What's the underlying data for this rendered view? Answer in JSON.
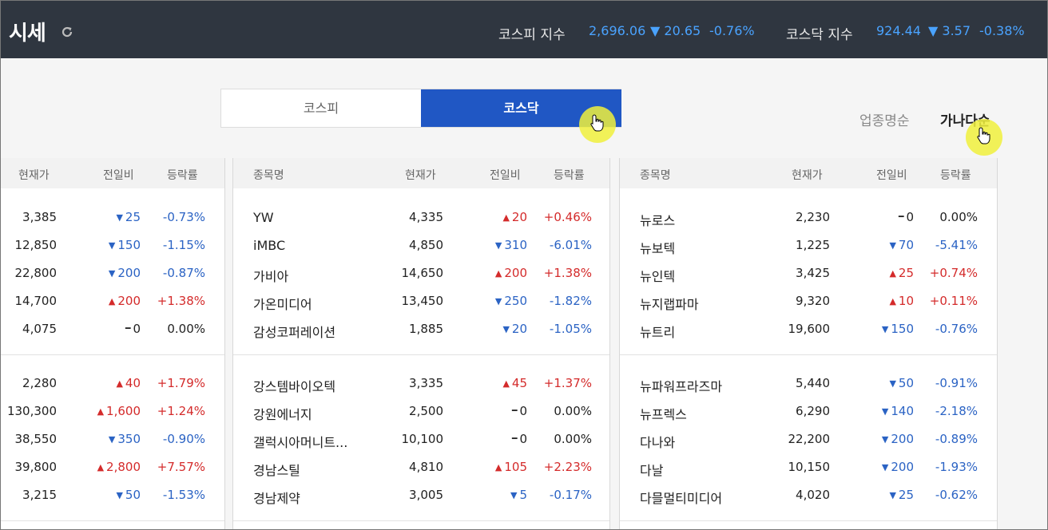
{
  "header": {
    "title": "시세",
    "kospi": {
      "name": "코스피 지수",
      "value": "2,696.06",
      "change": "▼ 20.65",
      "rate": "-0.76%"
    },
    "kosdaq": {
      "name": "코스닥 지수",
      "value": "924.44",
      "change": "▼ 3.57",
      "rate": "-0.38%"
    }
  },
  "market_tabs": {
    "kospi": "코스피",
    "kosdaq": "코스닥",
    "active": "kosdaq"
  },
  "sort": {
    "by_industry": "업종명순",
    "alphabetical": "가나다순",
    "active": "alphabetical"
  },
  "colors": {
    "header_bg": "#2f3640",
    "accent": "#2057c4",
    "up": "#d42b2b",
    "down": "#2b63c4"
  },
  "columns": {
    "name": "종목명",
    "price": "현재가",
    "change": "전일비",
    "rate": "등락률"
  },
  "left_panel": {
    "rows": [
      {
        "price": "3,385",
        "dir": "down",
        "change": "25",
        "rate": "-0.73%"
      },
      {
        "price": "12,850",
        "dir": "down",
        "change": "150",
        "rate": "-1.15%"
      },
      {
        "price": "22,800",
        "dir": "down",
        "change": "200",
        "rate": "-0.87%"
      },
      {
        "price": "14,700",
        "dir": "up",
        "change": "200",
        "rate": "+1.38%"
      },
      {
        "price": "4,075",
        "dir": "flat",
        "change": "0",
        "rate": "0.00%"
      },
      {
        "price": "2,280",
        "dir": "up",
        "change": "40",
        "rate": "+1.79%"
      },
      {
        "price": "130,300",
        "dir": "up",
        "change": "1,600",
        "rate": "+1.24%"
      },
      {
        "price": "38,550",
        "dir": "down",
        "change": "350",
        "rate": "-0.90%"
      },
      {
        "price": "39,800",
        "dir": "up",
        "change": "2,800",
        "rate": "+7.57%"
      },
      {
        "price": "3,215",
        "dir": "down",
        "change": "50",
        "rate": "-1.53%"
      }
    ]
  },
  "mid_panel": {
    "rows": [
      {
        "name": "YW",
        "price": "4,335",
        "dir": "up",
        "change": "20",
        "rate": "+0.46%"
      },
      {
        "name": "iMBC",
        "price": "4,850",
        "dir": "down",
        "change": "310",
        "rate": "-6.01%"
      },
      {
        "name": "가비아",
        "price": "14,650",
        "dir": "up",
        "change": "200",
        "rate": "+1.38%"
      },
      {
        "name": "가온미디어",
        "price": "13,450",
        "dir": "down",
        "change": "250",
        "rate": "-1.82%"
      },
      {
        "name": "감성코퍼레이션",
        "price": "1,885",
        "dir": "down",
        "change": "20",
        "rate": "-1.05%"
      },
      {
        "name": "강스템바이오텍",
        "price": "3,335",
        "dir": "up",
        "change": "45",
        "rate": "+1.37%"
      },
      {
        "name": "강원에너지",
        "price": "2,500",
        "dir": "flat",
        "change": "0",
        "rate": "0.00%"
      },
      {
        "name": "갤럭시아머니트...",
        "price": "10,100",
        "dir": "flat",
        "change": "0",
        "rate": "0.00%"
      },
      {
        "name": "경남스틸",
        "price": "4,810",
        "dir": "up",
        "change": "105",
        "rate": "+2.23%"
      },
      {
        "name": "경남제약",
        "price": "3,005",
        "dir": "down",
        "change": "5",
        "rate": "-0.17%"
      }
    ]
  },
  "right_panel": {
    "rows": [
      {
        "name": "뉴로스",
        "price": "2,230",
        "dir": "flat",
        "change": "0",
        "rate": "0.00%"
      },
      {
        "name": "뉴보텍",
        "price": "1,225",
        "dir": "down",
        "change": "70",
        "rate": "-5.41%"
      },
      {
        "name": "뉴인텍",
        "price": "3,425",
        "dir": "up",
        "change": "25",
        "rate": "+0.74%"
      },
      {
        "name": "뉴지랩파마",
        "price": "9,320",
        "dir": "up",
        "change": "10",
        "rate": "+0.11%"
      },
      {
        "name": "뉴트리",
        "price": "19,600",
        "dir": "down",
        "change": "150",
        "rate": "-0.76%"
      },
      {
        "name": "뉴파워프라즈마",
        "price": "5,440",
        "dir": "down",
        "change": "50",
        "rate": "-0.91%"
      },
      {
        "name": "뉴프렉스",
        "price": "6,290",
        "dir": "down",
        "change": "140",
        "rate": "-2.18%"
      },
      {
        "name": "다나와",
        "price": "22,200",
        "dir": "down",
        "change": "200",
        "rate": "-0.89%"
      },
      {
        "name": "다날",
        "price": "10,150",
        "dir": "down",
        "change": "200",
        "rate": "-1.93%"
      },
      {
        "name": "다믈멀티미디어",
        "price": "4,020",
        "dir": "down",
        "change": "25",
        "rate": "-0.62%"
      }
    ]
  }
}
